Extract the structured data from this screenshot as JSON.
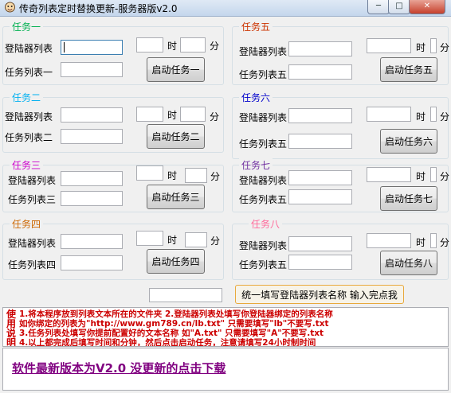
{
  "window": {
    "title": "传奇列表定时替换更新-服务器版v2.0",
    "controls": {
      "minimize": "─",
      "maximize": "□",
      "close": "✕"
    }
  },
  "colors": {
    "task1": "#00b050",
    "task2": "#00b0f0",
    "task3": "#cc00cc",
    "task4": "#cc6600",
    "task5": "#cc3300",
    "task6": "#0000cc",
    "task7": "#7030a0",
    "task8": "#ff6699",
    "instructions": "#cc0000",
    "link": "#800080"
  },
  "labels": {
    "hour": "时",
    "minute": "分"
  },
  "tasks": [
    {
      "title": "任务一",
      "server_list_label": "登陆器列表",
      "task_list_label": "任务列表一",
      "start_button": "启动任务一"
    },
    {
      "title": "任务二",
      "server_list_label": "登陆器列表",
      "task_list_label": "任务列表二",
      "start_button": "启动任务二"
    },
    {
      "title": "任务三",
      "server_list_label": "登陆器列表",
      "task_list_label": "任务列表三",
      "start_button": "启动任务三"
    },
    {
      "title": "任务四",
      "server_list_label": "登陆器列表",
      "task_list_label": "任务列表四",
      "start_button": "启动任务四"
    },
    {
      "title": "任务五",
      "server_list_label": "登陆器列表",
      "task_list_label": "任务列表五",
      "start_button": "启动任务五"
    },
    {
      "title": "任务六",
      "server_list_label": "登陆器列表",
      "task_list_label": "任务列表五",
      "start_button": "启动任务六"
    },
    {
      "title": "任务七",
      "server_list_label": "登陆器列表",
      "task_list_label": "任务列表五",
      "start_button": "启动任务七"
    },
    {
      "title": "任务八",
      "server_list_label": "登陆器列表",
      "task_list_label": "任务列表五",
      "start_button": "启动任务八"
    }
  ],
  "unified": {
    "input_value": "",
    "button_label": "统一填写登陆器列表名称 输入完点我"
  },
  "instructions": {
    "side": [
      "使",
      "用",
      "说",
      "明"
    ],
    "lines": [
      "1.将本程序放到列表文本所在的文件夹    2.登陆器列表处填写你登陆器绑定的列表名称",
      "  如你绑定的列表为\"http://www.gm789.cn/lb.txt\" 只需要填写\"lb\"不要写.txt",
      "3.任务列表处填写你提前配置好的文本名称 如\"A.txt\" 只需要填写\"A\"不要写.txt",
      "4.以上都完成后填写时间和分钟，然后点击启动任务，注意请填写24小时制时间"
    ]
  },
  "footer": {
    "update_link": "软件最新版本为V2.0 没更新的点击下载"
  }
}
